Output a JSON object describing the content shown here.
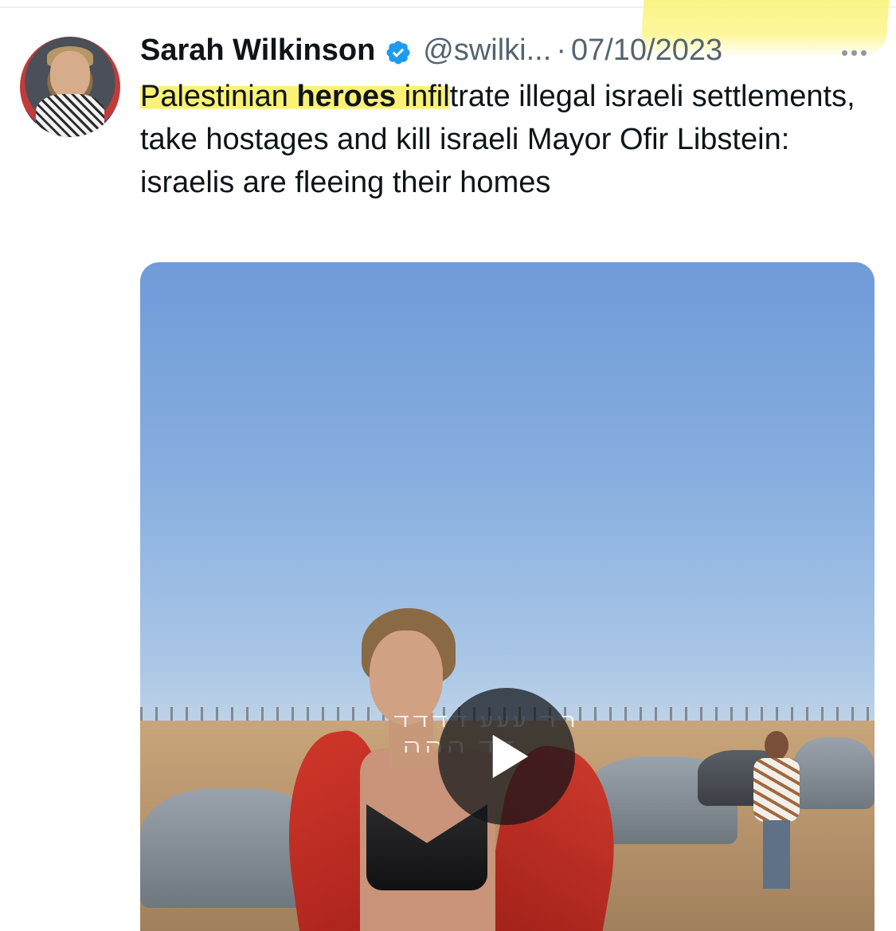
{
  "tweet": {
    "author": {
      "name": "Sarah Wilkinson",
      "handle": "@swilki...",
      "verified": true
    },
    "separator": "·",
    "date": "07/10/2023",
    "text": {
      "segment_1_highlighted": "Palestinian ",
      "segment_2_highlighted_bold": "heroes",
      "segment_3_highlighted": " infil",
      "segment_4": "trate illegal israeli settlements, take hostages and kill israeli Mayor Ofir Libstein: israelis are fleeing their homes"
    },
    "media": {
      "type": "video",
      "overlay_line_1": "ﬧﬧ ﬠﬠﬠ ﬢﬢﬢﬢ",
      "overlay_line_2": "ﬢﬢ ﬣﬣﬣ"
    }
  },
  "icons": {
    "verified": "verified-badge-icon",
    "more": "more-options-icon",
    "play": "play-icon"
  },
  "colors": {
    "verified_blue": "#1d9bf0",
    "text_primary": "#0f1419",
    "text_secondary": "#536471",
    "highlight_yellow": "#faf06e"
  }
}
